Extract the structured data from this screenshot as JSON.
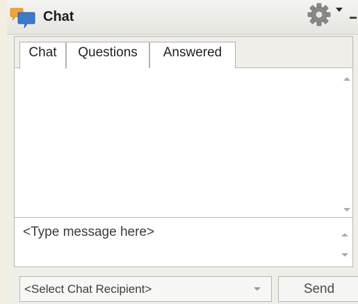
{
  "window": {
    "title": "Chat",
    "icons": {
      "app": "chat-bubbles-icon",
      "settings": "gear-icon",
      "minimize": "minimize-icon"
    }
  },
  "tabs": [
    {
      "label": "Chat",
      "active": true
    },
    {
      "label": "Questions",
      "active": false
    },
    {
      "label": "Answered",
      "active": false
    }
  ],
  "compose": {
    "placeholder": "<Type message here>"
  },
  "footer": {
    "recipient_placeholder": "<Select Chat Recipient>",
    "send_label": "Send"
  },
  "colors": {
    "title_text": "#1d1d1d",
    "chat_icon_blue": "#3f79c9",
    "chat_icon_orange": "#f2a33a"
  }
}
